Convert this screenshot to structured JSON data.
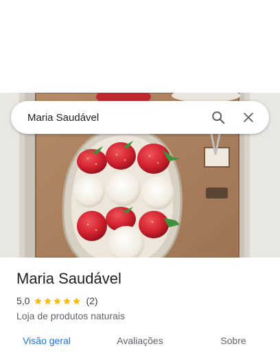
{
  "search": {
    "value": "Maria Saudável",
    "icon": "search-icon",
    "clear_icon": "close-icon"
  },
  "place": {
    "name": "Maria Saudável",
    "rating": "5,0",
    "stars": 5,
    "reviews": "(2)",
    "category": "Loja de produtos naturais"
  },
  "tabs": [
    {
      "label": "Visão geral",
      "active": true
    },
    {
      "label": "Avaliações",
      "active": false
    },
    {
      "label": "Sobre",
      "active": false
    }
  ],
  "colors": {
    "accent": "#1a73e8",
    "star": "#fbbc04"
  }
}
